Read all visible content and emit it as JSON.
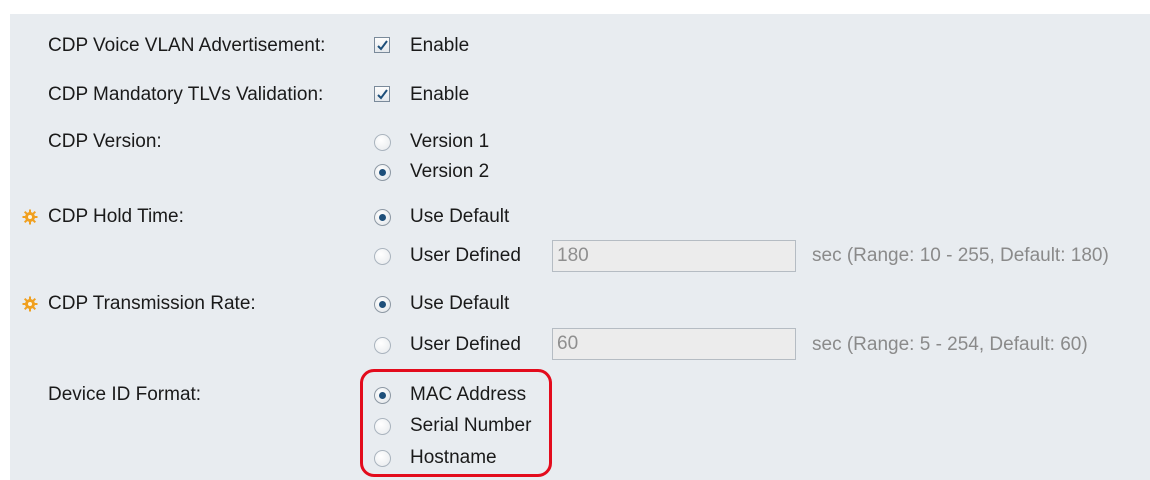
{
  "settings": {
    "voice_vlan": {
      "label": "CDP Voice VLAN Advertisement:",
      "option": "Enable",
      "checked": true
    },
    "mandatory_tlvs": {
      "label": "CDP Mandatory TLVs Validation:",
      "option": "Enable",
      "checked": true
    },
    "version": {
      "label": "CDP Version:",
      "options": [
        "Version 1",
        "Version 2"
      ],
      "selected": "Version 2"
    },
    "hold_time": {
      "label": "CDP Hold Time:",
      "use_default": "Use Default",
      "user_defined": "User Defined",
      "value": "180",
      "hint": "sec (Range: 10 - 255, Default: 180)",
      "selected": "Use Default"
    },
    "transmission_rate": {
      "label": "CDP Transmission Rate:",
      "use_default": "Use Default",
      "user_defined": "User Defined",
      "value": "60",
      "hint": "sec (Range: 5 - 254, Default: 60)",
      "selected": "Use Default"
    },
    "device_id_format": {
      "label": "Device ID Format:",
      "options": [
        "MAC Address",
        "Serial Number",
        "Hostname"
      ],
      "selected": "MAC Address"
    }
  },
  "colors": {
    "panel": "#e8ecf0",
    "highlight": "#e30b1c",
    "required_gear": "#f0a020",
    "hint_text": "#8a8a8a"
  },
  "icons": {
    "required": "gear-icon",
    "checkbox_mark": "checkmark-icon"
  }
}
